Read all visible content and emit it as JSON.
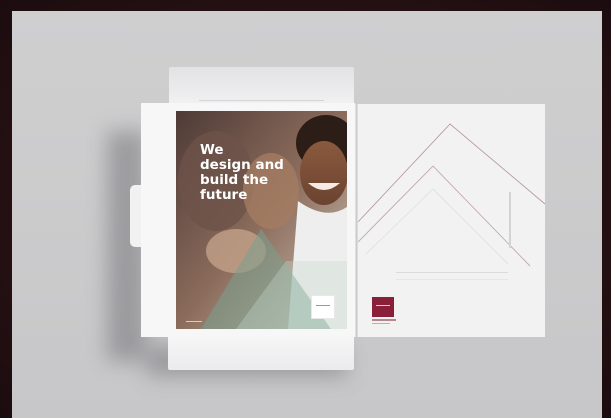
{
  "scene": {
    "background_color": "#2a1418",
    "surface_color": "#c9c9cb"
  },
  "brochure": {
    "headline_lines": [
      "We",
      "design and",
      "build the",
      "future"
    ],
    "accent_color": "#8a1f3a"
  },
  "folder": {
    "logo_icon": "brand-logo-icon",
    "brand_color": "#8a1f3a"
  }
}
